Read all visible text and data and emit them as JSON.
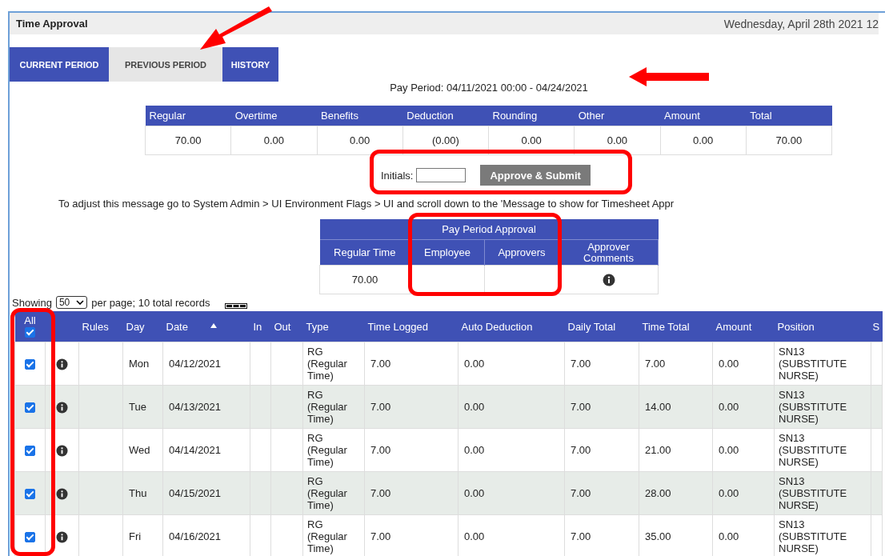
{
  "header": {
    "title": "Time Approval",
    "date": "Wednesday, April 28th 2021 12"
  },
  "tabs": [
    {
      "label": "CURRENT PERIOD",
      "selected": false
    },
    {
      "label": "PREVIOUS PERIOD",
      "selected": true
    },
    {
      "label": "HISTORY",
      "selected": false
    }
  ],
  "pay_period": "Pay Period: 04/11/2021 00:00 - 04/24/2021",
  "summary": {
    "columns": [
      "Regular",
      "Overtime",
      "Benefits",
      "Deduction",
      "Rounding",
      "Other",
      "Amount",
      "Total"
    ],
    "values": [
      "70.00",
      "0.00",
      "0.00",
      "(0.00)",
      "0.00",
      "0.00",
      "0.00",
      "70.00"
    ]
  },
  "initials": {
    "label": "Initials:",
    "button": "Approve & Submit"
  },
  "message": "To adjust this message go to System Admin > UI Environment Flags > UI and scroll down to the 'Message to show for Timesheet Appr",
  "approval": {
    "title": "Pay Period Approval",
    "columns": [
      "Regular Time",
      "Employee",
      "Approvers",
      "Approver Comments"
    ],
    "regular_time": "70.00"
  },
  "paging": {
    "prefix": "Showing",
    "per_page": "50",
    "suffix": "per page; 10 total records"
  },
  "table": {
    "all_label": "All",
    "all_checked": true,
    "columns": [
      "Rules",
      "Day",
      "Date",
      "In",
      "Out",
      "Type",
      "Time Logged",
      "Auto Deduction",
      "Daily Total",
      "Time Total",
      "Amount",
      "Position",
      "S"
    ],
    "rows": [
      {
        "checked": true,
        "day": "Mon",
        "date": "04/12/2021",
        "type": "RG (Regular Time)",
        "time_logged": "7.00",
        "auto_deduction": "0.00",
        "daily_total": "7.00",
        "time_total": "7.00",
        "amount": "0.00",
        "position": "SN13 (SUBSTITUTE NURSE)"
      },
      {
        "checked": true,
        "day": "Tue",
        "date": "04/13/2021",
        "type": "RG (Regular Time)",
        "time_logged": "7.00",
        "auto_deduction": "0.00",
        "daily_total": "7.00",
        "time_total": "14.00",
        "amount": "0.00",
        "position": "SN13 (SUBSTITUTE NURSE)"
      },
      {
        "checked": true,
        "day": "Wed",
        "date": "04/14/2021",
        "type": "RG (Regular Time)",
        "time_logged": "7.00",
        "auto_deduction": "0.00",
        "daily_total": "7.00",
        "time_total": "21.00",
        "amount": "0.00",
        "position": "SN13 (SUBSTITUTE NURSE)"
      },
      {
        "checked": true,
        "day": "Thu",
        "date": "04/15/2021",
        "type": "RG (Regular Time)",
        "time_logged": "7.00",
        "auto_deduction": "0.00",
        "daily_total": "7.00",
        "time_total": "28.00",
        "amount": "0.00",
        "position": "SN13 (SUBSTITUTE NURSE)"
      },
      {
        "checked": true,
        "day": "Fri",
        "date": "04/16/2021",
        "type": "RG (Regular Time)",
        "time_logged": "7.00",
        "auto_deduction": "0.00",
        "daily_total": "7.00",
        "time_total": "35.00",
        "amount": "0.00",
        "position": "SN13 (SUBSTITUTE NURSE)"
      }
    ]
  },
  "annotations": [
    {
      "kind": "arrow"
    },
    {
      "kind": "arrow"
    },
    {
      "kind": "box"
    },
    {
      "kind": "box"
    },
    {
      "kind": "box"
    }
  ]
}
